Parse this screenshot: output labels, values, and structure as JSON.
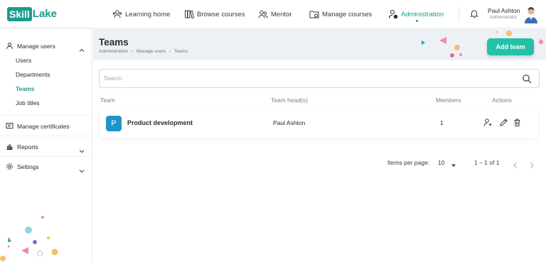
{
  "brand": {
    "part1": "Skill",
    "part2": "Lake"
  },
  "nav": [
    {
      "label": "Learning home",
      "icon": "users-group-icon"
    },
    {
      "label": "Browse courses",
      "icon": "books-icon"
    },
    {
      "label": "Mentor",
      "icon": "mentor-icon"
    },
    {
      "label": "Manage courses",
      "icon": "manage-courses-icon"
    },
    {
      "label": "Administration",
      "icon": "admin-user-icon",
      "active": true
    }
  ],
  "user": {
    "name": "Paul Ashton",
    "role": "Administrator"
  },
  "sidebar": {
    "manage_users": "Manage users",
    "items": [
      "Users",
      "Departments",
      "Teams",
      "Job titles"
    ],
    "active_item": "Teams",
    "manage_certificates": "Manage certificates",
    "reports": "Reports",
    "settings": "Settings"
  },
  "page": {
    "title": "Teams",
    "breadcrumb": [
      "Administration",
      "Manage users",
      "Teams"
    ],
    "add_button": "Add team"
  },
  "search": {
    "placeholder": "Search"
  },
  "table": {
    "columns": [
      "Team",
      "Team head(s)",
      "Members",
      "Actions"
    ],
    "rows": [
      {
        "initial": "P",
        "name": "Product development",
        "head": "Paul Ashton",
        "members": "1"
      }
    ]
  },
  "pagination": {
    "items_per_page_label": "Items per page:",
    "per_page": "10",
    "range": "1 – 1 of 1"
  },
  "colors": {
    "accent": "#1a9c8c",
    "button": "#23c2a7",
    "team_avatar": "#2193c9"
  }
}
